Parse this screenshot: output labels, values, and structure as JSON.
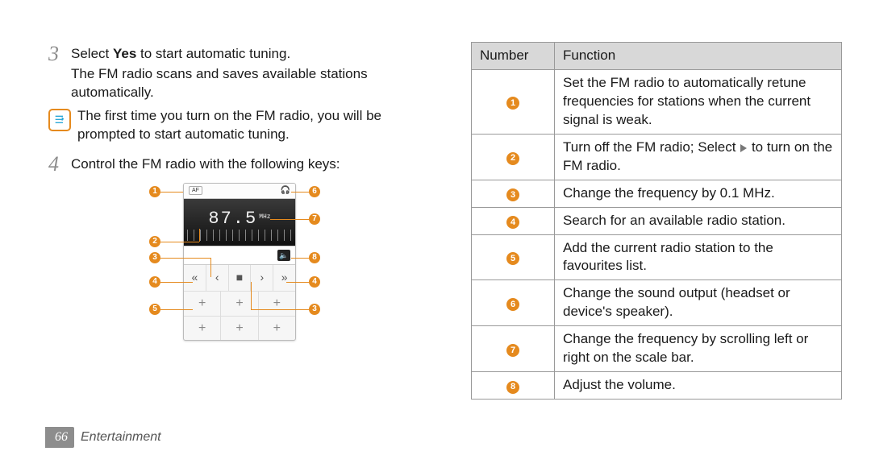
{
  "steps": {
    "s3": {
      "num": "3",
      "line1_a": "Select ",
      "line1_b": "Yes",
      "line1_c": " to start automatic tuning.",
      "line2": "The FM radio scans and saves available stations automatically."
    },
    "note": "The first time you turn on the FM radio, you will be prompted to start automatic tuning.",
    "s4": {
      "num": "4",
      "line": "Control the FM radio with the following keys:"
    }
  },
  "device": {
    "af_label": "AF",
    "freq_value": "87.5",
    "freq_unit": "MHz",
    "hp_icon_name": "headphones-icon",
    "speaker_icon_name": "speaker-icon",
    "ctrl_symbols": [
      "«",
      "‹",
      "■",
      "›",
      "»"
    ],
    "fav_symbol": "+"
  },
  "callouts": [
    "1",
    "2",
    "3",
    "4",
    "5",
    "6",
    "7",
    "8"
  ],
  "table": {
    "head_number": "Number",
    "head_function": "Function",
    "rows": [
      {
        "n": "1",
        "text": "Set the FM radio to automatically retune frequencies for stations when the current signal is weak."
      },
      {
        "n": "2",
        "text_a": "Turn off the FM radio; Select ",
        "text_b": " to turn on the FM radio."
      },
      {
        "n": "3",
        "text": "Change the frequency by 0.1 MHz."
      },
      {
        "n": "4",
        "text": "Search for an available radio station."
      },
      {
        "n": "5",
        "text": "Add the current radio station to the favourites list."
      },
      {
        "n": "6",
        "text": "Change the sound output (headset or device's speaker)."
      },
      {
        "n": "7",
        "text": "Change the frequency by scrolling left or right on the scale bar."
      },
      {
        "n": "8",
        "text": "Adjust the volume."
      }
    ]
  },
  "footer": {
    "page": "66",
    "section": "Entertainment"
  }
}
